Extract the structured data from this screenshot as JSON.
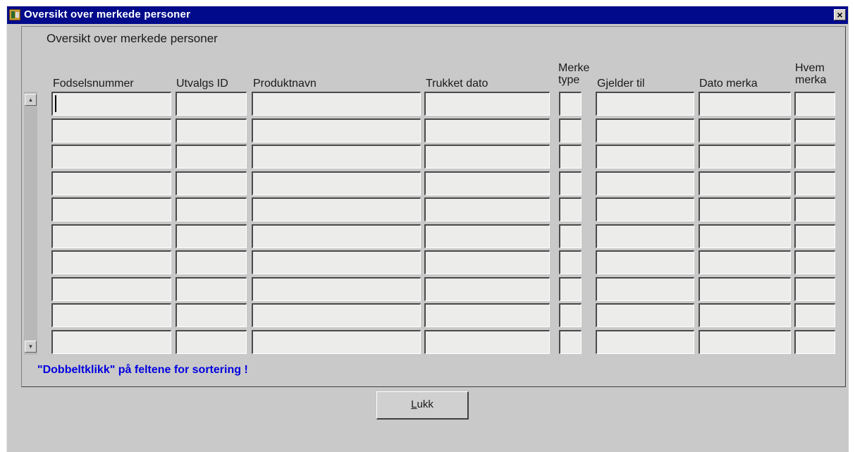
{
  "window": {
    "title": "Oversikt over merkede personer",
    "close_glyph": "×"
  },
  "group_title": "Oversikt over merkede personer",
  "columns": [
    {
      "key": "fodselsnummer",
      "line1": "",
      "line2": "Fodselsnummer"
    },
    {
      "key": "utvalgs_id",
      "line1": "",
      "line2": "Utvalgs ID"
    },
    {
      "key": "produktnavn",
      "line1": "",
      "line2": "Produktnavn"
    },
    {
      "key": "trukket_dato",
      "line1": "",
      "line2": "Trukket dato"
    },
    {
      "key": "merke_type",
      "line1": "Merke",
      "line2": "type"
    },
    {
      "key": "gjelder_til",
      "line1": "",
      "line2": "Gjelder til"
    },
    {
      "key": "dato_merka",
      "line1": "",
      "line2": "Dato merka"
    },
    {
      "key": "hvem_merka",
      "line1": "Hvem",
      "line2": "merka"
    }
  ],
  "rows": [
    [
      "",
      "",
      "",
      "",
      "",
      "",
      "",
      ""
    ],
    [
      "",
      "",
      "",
      "",
      "",
      "",
      "",
      ""
    ],
    [
      "",
      "",
      "",
      "",
      "",
      "",
      "",
      ""
    ],
    [
      "",
      "",
      "",
      "",
      "",
      "",
      "",
      ""
    ],
    [
      "",
      "",
      "",
      "",
      "",
      "",
      "",
      ""
    ],
    [
      "",
      "",
      "",
      "",
      "",
      "",
      "",
      ""
    ],
    [
      "",
      "",
      "",
      "",
      "",
      "",
      "",
      ""
    ],
    [
      "",
      "",
      "",
      "",
      "",
      "",
      "",
      ""
    ],
    [
      "",
      "",
      "",
      "",
      "",
      "",
      "",
      ""
    ],
    [
      "",
      "",
      "",
      "",
      "",
      "",
      "",
      ""
    ]
  ],
  "scrollbar": {
    "up_glyph": "▲",
    "down_glyph": "▼"
  },
  "hint": "\"Dobbeltklikk\" på feltene for sortering !",
  "close_button": {
    "accel": "L",
    "rest": "ukk"
  },
  "colors": {
    "title_bar": "#000a8a",
    "hint_text": "#0000e0",
    "background": "#c9c9c9"
  }
}
